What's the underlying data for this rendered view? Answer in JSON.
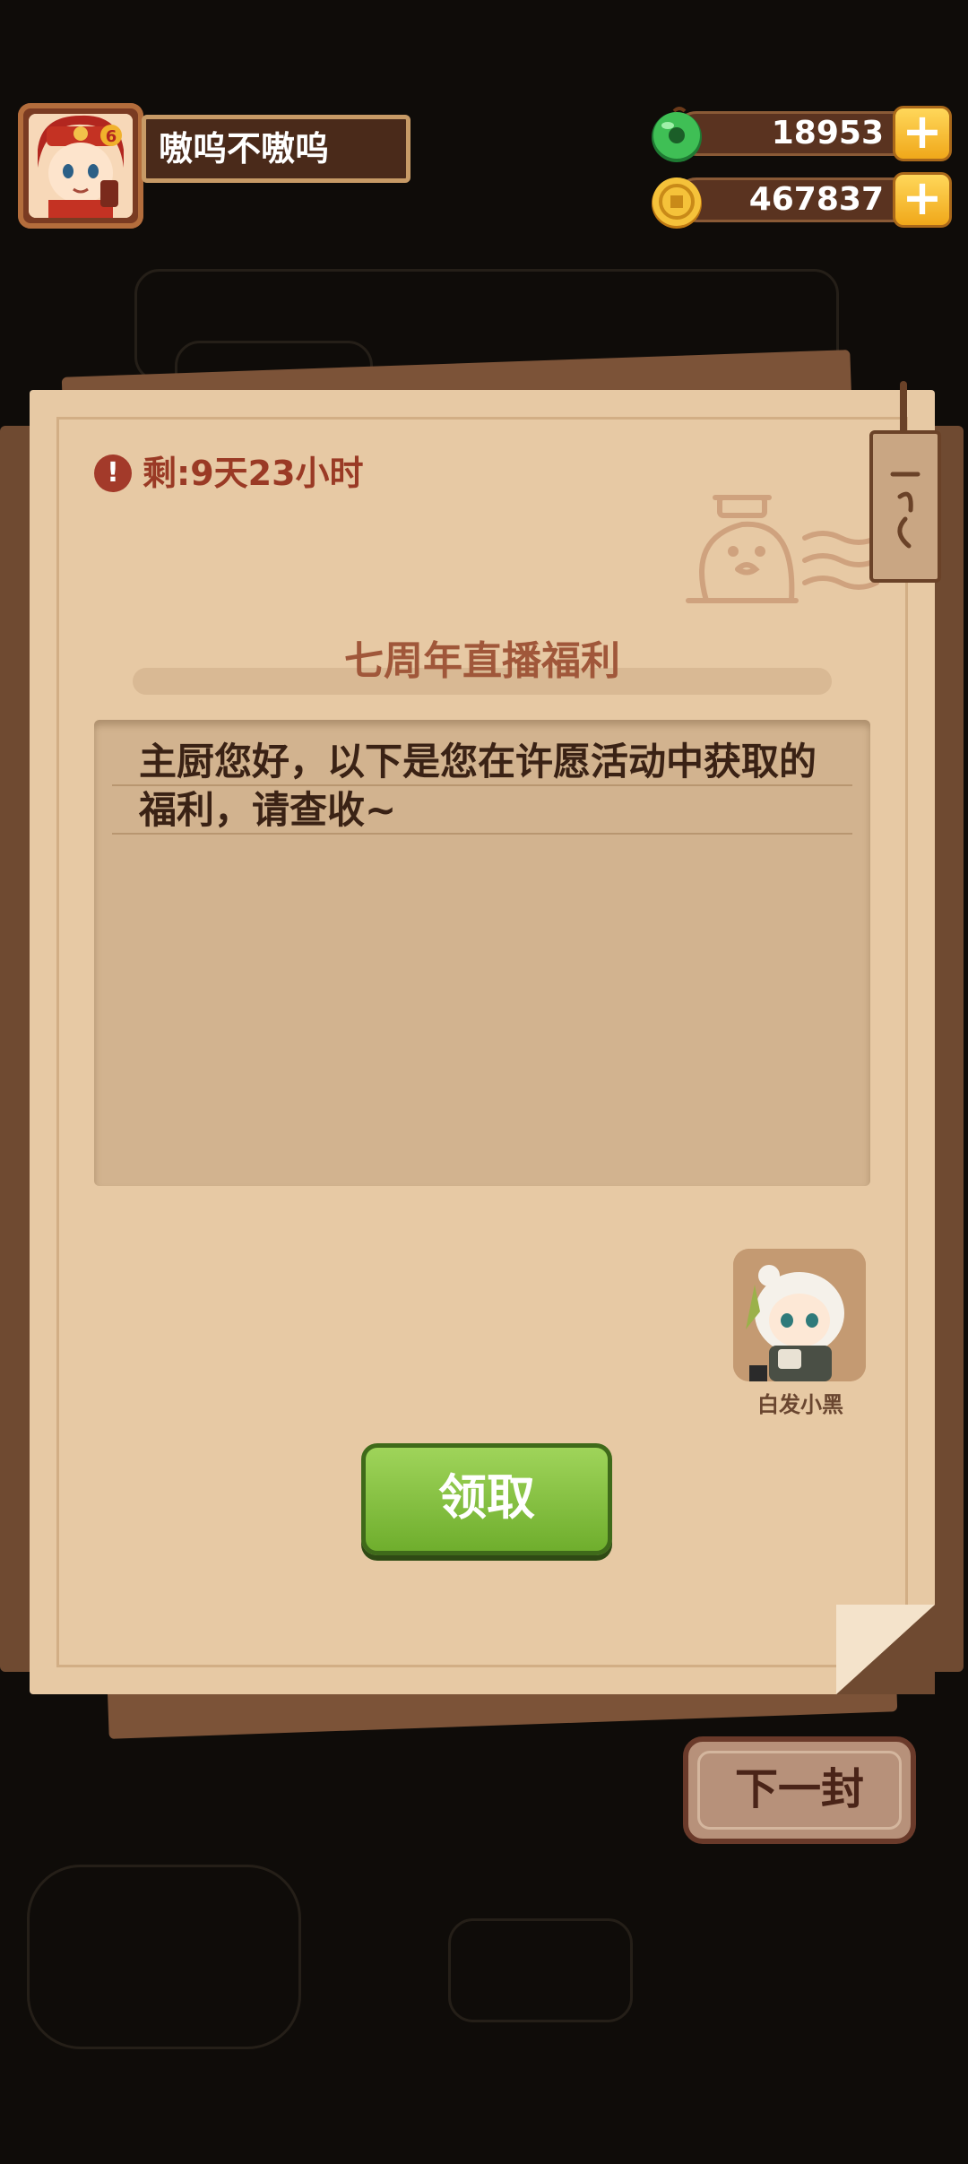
{
  "player": {
    "name": "嗷呜不嗷呜"
  },
  "currencies": [
    {
      "icon": "jade-icon",
      "value": "18953",
      "color": "#33a84a"
    },
    {
      "icon": "coin-icon",
      "value": "467837",
      "color": "#f2b62a"
    }
  ],
  "letter": {
    "remaining": "剩:9天23小时",
    "title": "七周年直播福利",
    "body": "主厨您好，以下是您在许愿活动中获取的福利，请查收~",
    "sender_name": "白发小黑",
    "claim_label": "领取"
  },
  "next_label": "下一封",
  "colors": {
    "paper": "#e7c9a4",
    "claim_green": "#7bbd35",
    "title_brown": "#a0573a"
  }
}
